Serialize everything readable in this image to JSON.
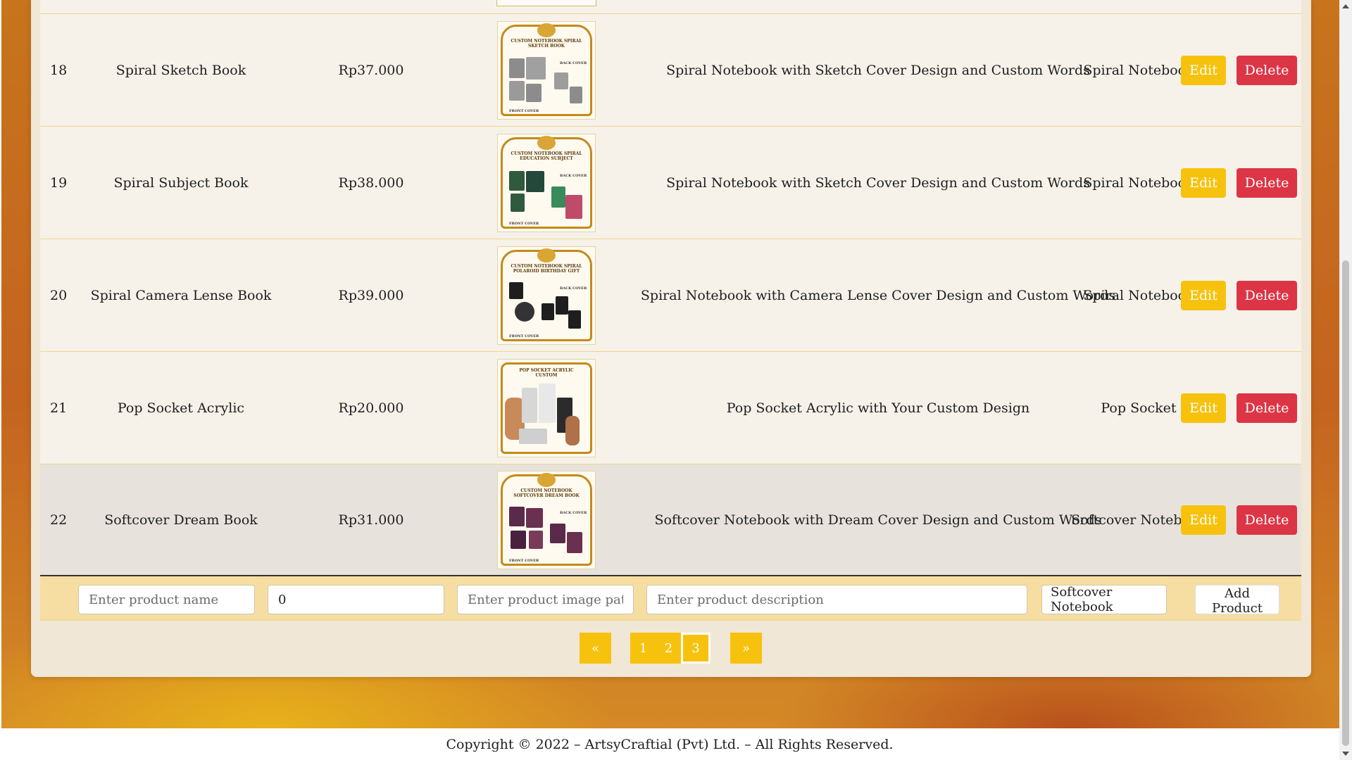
{
  "products": [
    {
      "id": "18",
      "name": "Spiral Sketch Book",
      "price": "Rp37.000",
      "image_title": "CUSTOM NOTEBOOK SPIRAL SKETCH BOOK",
      "description": "Spiral Notebook with Sketch Cover Design and Custom Words",
      "category": "Spiral Notebook",
      "theme": "#8c8c8c"
    },
    {
      "id": "19",
      "name": "Spiral Subject Book",
      "price": "Rp38.000",
      "image_title": "CUSTOM NOTEBOOK SPIRAL EDUCATION SUBJECT",
      "description": "Spiral Notebook with Sketch Cover Design and Custom Words",
      "category": "Spiral Notebook",
      "theme": "#2f5a3e"
    },
    {
      "id": "20",
      "name": "Spiral Camera Lense Book",
      "price": "Rp39.000",
      "image_title": "CUSTOM NOTEBOOK SPIRAL POLAROID BIRTHDAY GIFT",
      "description": "Spiral Notebook with Camera Lense Cover Design and Custom Words",
      "category": "Spiral Notebook",
      "theme": "#1e1e1e"
    },
    {
      "id": "21",
      "name": "Pop Socket Acrylic",
      "price": "Rp20.000",
      "image_title": "POP SOCKET ACRYLIC CUSTOM",
      "description": "Pop Socket Acrylic with Your Custom Design",
      "category": "Pop Socket",
      "theme": "#d7d7d7"
    },
    {
      "id": "22",
      "name": "Softcover Dream Book",
      "price": "Rp31.000",
      "image_title": "CUSTOM NOTEBOOK SOFTCOVER DREAM BOOK",
      "description": "Softcover Notebook with Dream Cover Design and Custom Words",
      "category": "Softcover Notebook",
      "theme": "#5a2a4a"
    }
  ],
  "image_labels": {
    "back": "BACK COVER",
    "front": "FRONT COVER"
  },
  "actions": {
    "edit": "Edit",
    "delete": "Delete"
  },
  "form": {
    "name_placeholder": "Enter product name",
    "price_value": "0",
    "image_placeholder": "Enter product image path",
    "description_placeholder": "Enter product description",
    "category_selected": "Softcover Notebook",
    "add_label": "Add Product"
  },
  "pagination": {
    "first": "«",
    "pages": [
      "1",
      "2",
      "3"
    ],
    "active_page": "3",
    "last": "»"
  },
  "footer": {
    "text": "Copyright © 2022 – ArtsyCraftial (Pvt) Ltd. – All Rights Reserved."
  },
  "colors": {
    "edit": "#f7c20e",
    "delete": "#dc3545",
    "pager": "#f7c20e"
  }
}
